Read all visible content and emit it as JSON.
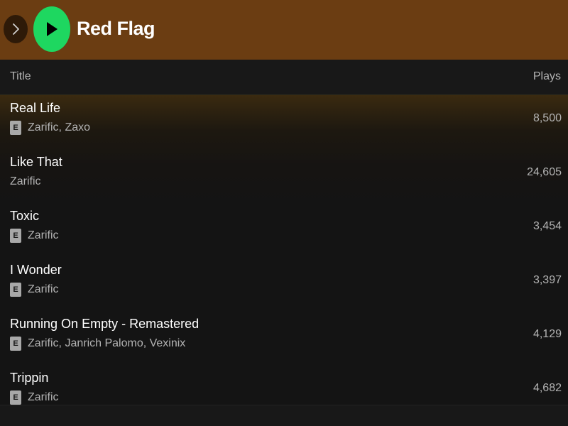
{
  "header": {
    "title": "Red Flag",
    "forward_icon": "chevron-right-icon",
    "play_icon": "play-icon",
    "colors": {
      "header_bg": "#6b3d12",
      "play_button": "#1ed760"
    }
  },
  "columns": {
    "title": "Title",
    "plays": "Plays"
  },
  "tracks": [
    {
      "name": "Real Life",
      "explicit": true,
      "explicit_label": "E",
      "artists": "Zarific, Zaxo",
      "plays": "8,500"
    },
    {
      "name": "Like That",
      "explicit": false,
      "explicit_label": "",
      "artists": "Zarific",
      "plays": "24,605"
    },
    {
      "name": "Toxic",
      "explicit": true,
      "explicit_label": "E",
      "artists": "Zarific",
      "plays": "3,454"
    },
    {
      "name": "I Wonder",
      "explicit": true,
      "explicit_label": "E",
      "artists": "Zarific",
      "plays": "3,397"
    },
    {
      "name": "Running On Empty - Remastered",
      "explicit": true,
      "explicit_label": "E",
      "artists": "Zarific, Janrich Palomo, Vexinix",
      "plays": "4,129"
    },
    {
      "name": "Trippin",
      "explicit": true,
      "explicit_label": "E",
      "artists": "Zarific",
      "plays": "4,682"
    }
  ]
}
